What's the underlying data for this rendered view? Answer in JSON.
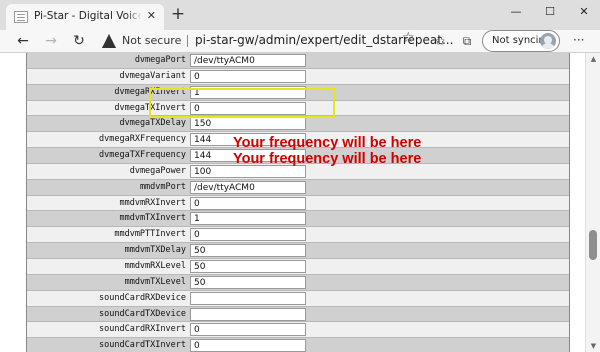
{
  "browser": {
    "tab_title": "Pi-Star - Digital Voice Dashboard",
    "tab_close": "✕",
    "new_tab": "+",
    "minimize": "—",
    "maximize": "☐",
    "close": "✕",
    "back": "←",
    "forward": "→",
    "reload": "↻",
    "security_text": "Not secure",
    "url": "pi-star-gw/admin/expert/edit_dstarrepeat...",
    "sync_label": "Not syncing",
    "menu": "···"
  },
  "icons": {
    "favicon": "page-icon",
    "warning": "warning-icon",
    "favorite": "star-icon",
    "favorites": "favorites-icon",
    "collections": "collections-icon"
  },
  "config_rows": [
    {
      "key": "dvmegaPort",
      "value": "/dev/ttyACM0"
    },
    {
      "key": "dvmegaVariant",
      "value": "0"
    },
    {
      "key": "dvmegaRXInvert",
      "value": "1"
    },
    {
      "key": "dvmegaTXInvert",
      "value": "0"
    },
    {
      "key": "dvmegaTXDelay",
      "value": "150"
    },
    {
      "key": "dvmegaRXFrequency",
      "value": "144"
    },
    {
      "key": "dvmegaTXFrequency",
      "value": "144"
    },
    {
      "key": "dvmegaPower",
      "value": "100"
    },
    {
      "key": "mmdvmPort",
      "value": "/dev/ttyACM0"
    },
    {
      "key": "mmdvmRXInvert",
      "value": "0"
    },
    {
      "key": "mmdvmTXInvert",
      "value": "1"
    },
    {
      "key": "mmdvmPTTInvert",
      "value": "0"
    },
    {
      "key": "mmdvmTXDelay",
      "value": "50"
    },
    {
      "key": "mmdvmRXLevel",
      "value": "50"
    },
    {
      "key": "mmdvmTXLevel",
      "value": "50"
    },
    {
      "key": "soundCardRXDevice",
      "value": ""
    },
    {
      "key": "soundCardTXDevice",
      "value": ""
    },
    {
      "key": "soundCardRXInvert",
      "value": "0"
    },
    {
      "key": "soundCardTXInvert",
      "value": "0"
    }
  ],
  "annotation": {
    "rx_note": "Your frequency will be here",
    "tx_note": "Your frequency will be here",
    "highlight_color": "#e6e61c",
    "note_color": "#d00000"
  },
  "colors": {
    "row_even": "#d0d0d0",
    "row_odd": "#f0f0f0"
  }
}
